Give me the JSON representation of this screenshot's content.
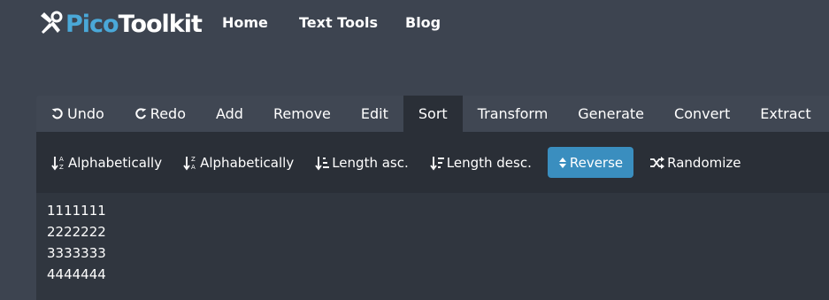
{
  "brand": {
    "part1": "Pico",
    "part2": "Toolkit",
    "accent": "#4aa8d8"
  },
  "nav": [
    {
      "label": "Home"
    },
    {
      "label": "Text Tools"
    },
    {
      "label": "Blog"
    }
  ],
  "tabs": [
    {
      "label": "Undo",
      "icon": "undo-icon"
    },
    {
      "label": "Redo",
      "icon": "redo-icon"
    },
    {
      "label": "Add"
    },
    {
      "label": "Remove"
    },
    {
      "label": "Edit"
    },
    {
      "label": "Sort",
      "active": true
    },
    {
      "label": "Transform"
    },
    {
      "label": "Generate"
    },
    {
      "label": "Convert"
    },
    {
      "label": "Extract"
    }
  ],
  "sort_options": [
    {
      "label": "Alphabetically",
      "icon": "sort-alpha-asc-icon"
    },
    {
      "label": "Alphabetically",
      "icon": "sort-alpha-desc-icon"
    },
    {
      "label": "Length asc.",
      "icon": "sort-length-asc-icon"
    },
    {
      "label": "Length desc.",
      "icon": "sort-length-desc-icon"
    },
    {
      "label": "Reverse",
      "icon": "sort-icon",
      "active": true
    },
    {
      "label": "Randomize",
      "icon": "shuffle-icon"
    }
  ],
  "editor": {
    "lines": [
      "1111111",
      "2222222",
      "3333333",
      "4444444"
    ]
  },
  "colors": {
    "background": "#3d4450",
    "panel": "#2a2f37",
    "editor": "#30363f",
    "active_button": "#3a8ebf"
  }
}
